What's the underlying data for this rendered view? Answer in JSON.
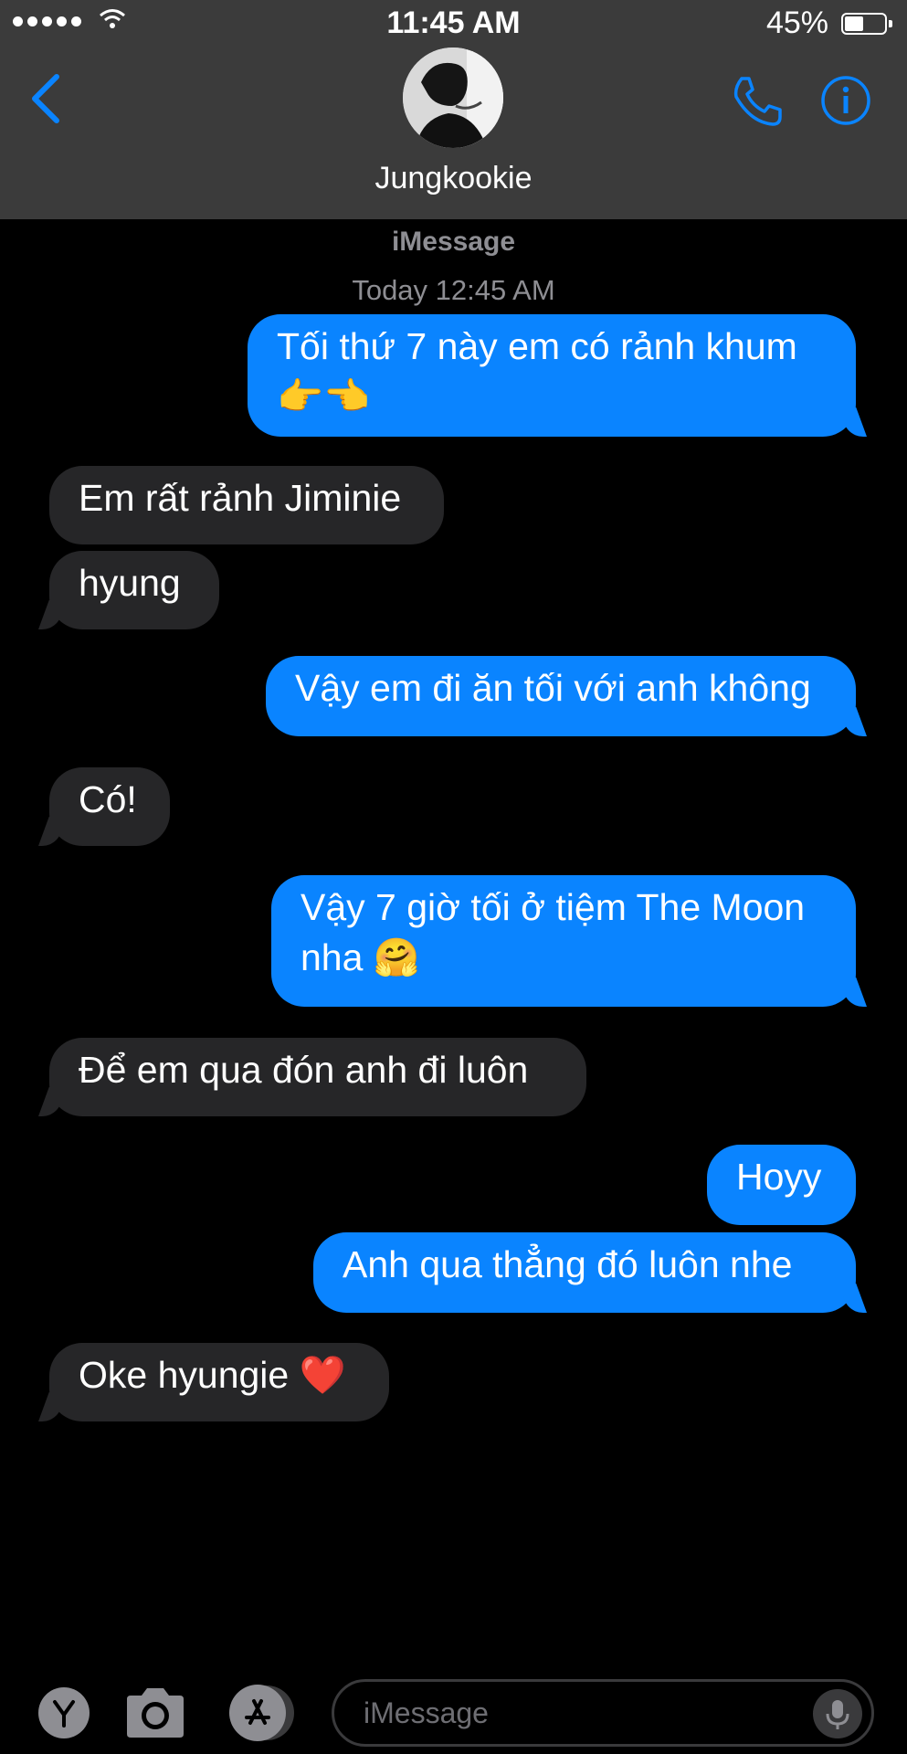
{
  "status_bar": {
    "time": "11:45 AM",
    "battery": "45%",
    "battery_level": 0.45
  },
  "header": {
    "contact_name": "Jungkookie"
  },
  "conversation": {
    "service": "iMessage",
    "timestamp": "Today 12:45 AM",
    "messages": [
      {
        "direction": "outgoing",
        "text": "Tối thứ 7 này em có rảnh khum",
        "emoji": "👉👈"
      },
      {
        "direction": "incoming",
        "text": "Em rất rảnh Jiminie"
      },
      {
        "direction": "incoming",
        "text": "hyung"
      },
      {
        "direction": "outgoing",
        "text": "Vậy em đi ăn tối với anh không"
      },
      {
        "direction": "incoming",
        "text": "Có!"
      },
      {
        "direction": "outgoing",
        "text": "Vậy 7 giờ tối ở tiệm The Moon",
        "text2": "nha",
        "emoji": "🤗"
      },
      {
        "direction": "incoming",
        "text": "Để em qua đón anh đi luôn"
      },
      {
        "direction": "outgoing",
        "text": "Hoyy"
      },
      {
        "direction": "outgoing",
        "text": "Anh qua thẳng đó luôn nhe"
      },
      {
        "direction": "incoming",
        "text": "Oke hyungie",
        "emoji": "❤️"
      }
    ]
  },
  "input_bar": {
    "placeholder": "iMessage"
  },
  "icons": {
    "back": "chevron-left-icon",
    "call": "phone-icon",
    "info": "info-icon",
    "apps": "app-drawer-icon",
    "camera": "camera-icon",
    "appstore": "app-store-icon",
    "mic": "mic-icon"
  },
  "colors": {
    "outgoing_bubble": "#0a84ff",
    "incoming_bubble": "#262628",
    "accent": "#0a84ff"
  }
}
